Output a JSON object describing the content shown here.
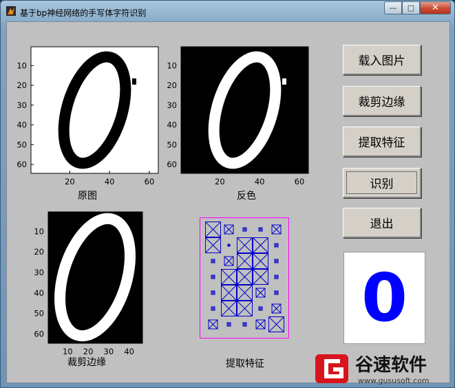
{
  "window": {
    "title": "基于bp神经网络的手写体字符识别",
    "controls": {
      "minimize": "—",
      "maximize": "□",
      "close": "✕"
    },
    "colors": {
      "client_bg": "#c0c0c0",
      "result_digit": "#0000ff",
      "feature_box": "#0000cc",
      "feature_frame": "#ff00ff"
    }
  },
  "panels": {
    "original": {
      "caption": "原图",
      "xticks": [
        "20",
        "40",
        "60"
      ],
      "yticks": [
        "10",
        "20",
        "30",
        "40",
        "50",
        "60"
      ]
    },
    "inverted": {
      "caption": "反色",
      "xticks": [
        "20",
        "40",
        "60"
      ],
      "yticks": [
        "10",
        "20",
        "30",
        "40",
        "50",
        "60"
      ]
    },
    "cropped": {
      "caption": "裁剪边缘",
      "xticks": [
        "10",
        "20",
        "30",
        "40"
      ],
      "yticks": [
        "10",
        "20",
        "30",
        "40",
        "50",
        "60"
      ]
    },
    "features": {
      "caption": "提取特征"
    }
  },
  "buttons": {
    "load": "载入图片",
    "crop": "裁剪边缘",
    "extract": "提取特征",
    "recognize": "识别",
    "exit": "退出"
  },
  "result": {
    "digit": "0"
  },
  "watermark": {
    "brand": "谷速软件",
    "url": "www.gususoft.com"
  }
}
